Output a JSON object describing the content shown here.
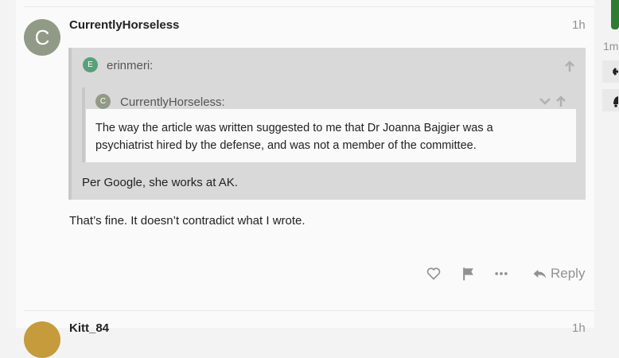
{
  "post": {
    "author": "CurrentlyHorseless",
    "avatar_letter": "C",
    "age": "1h",
    "quote": {
      "author": "erinmeri:",
      "avatar_letter": "E",
      "nested": {
        "author": "CurrentlyHorseless:",
        "avatar_letter": "C",
        "text": "The way the article was written suggested to me that Dr Joanna Bajgier was a psychiatrist hired by the defense, and was not a member of the committee."
      },
      "text": "Per Google, she works at AK."
    },
    "body": "That’s fine. It doesn’t contradict what I wrote.",
    "actions": {
      "reply_label": "Reply"
    }
  },
  "next_post": {
    "author": "Kitt_84",
    "age": "1h"
  },
  "sidebar": {
    "timestamp": "1m"
  },
  "colors": {
    "avatar_c": "#919a86",
    "avatar_e": "#58a07a",
    "avatar_next": "#c59b3b",
    "accent_green": "#2e7d32"
  }
}
